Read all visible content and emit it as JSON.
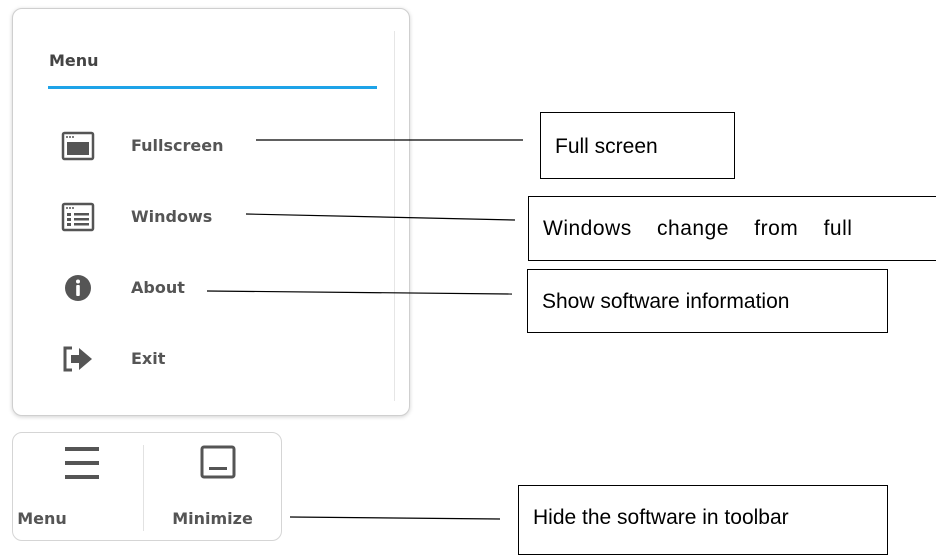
{
  "menu": {
    "title": "Menu",
    "items": [
      {
        "label": "Fullscreen",
        "icon": "fullscreen-window-icon"
      },
      {
        "label": "Windows",
        "icon": "windowed-list-icon"
      },
      {
        "label": "About",
        "icon": "info-icon"
      },
      {
        "label": "Exit",
        "icon": "exit-arrow-icon"
      }
    ]
  },
  "toolbar": {
    "menu_label": "Menu",
    "minimize_label": "Minimize"
  },
  "callouts": {
    "fullscreen": "Full screen",
    "windows": "Windows    change    from    full",
    "about": "Show software information",
    "minimize": "Hide the software in toolbar"
  },
  "colors": {
    "accent_underline": "#1ea3e8",
    "icon_gray": "#555555",
    "label_gray": "#555555"
  }
}
